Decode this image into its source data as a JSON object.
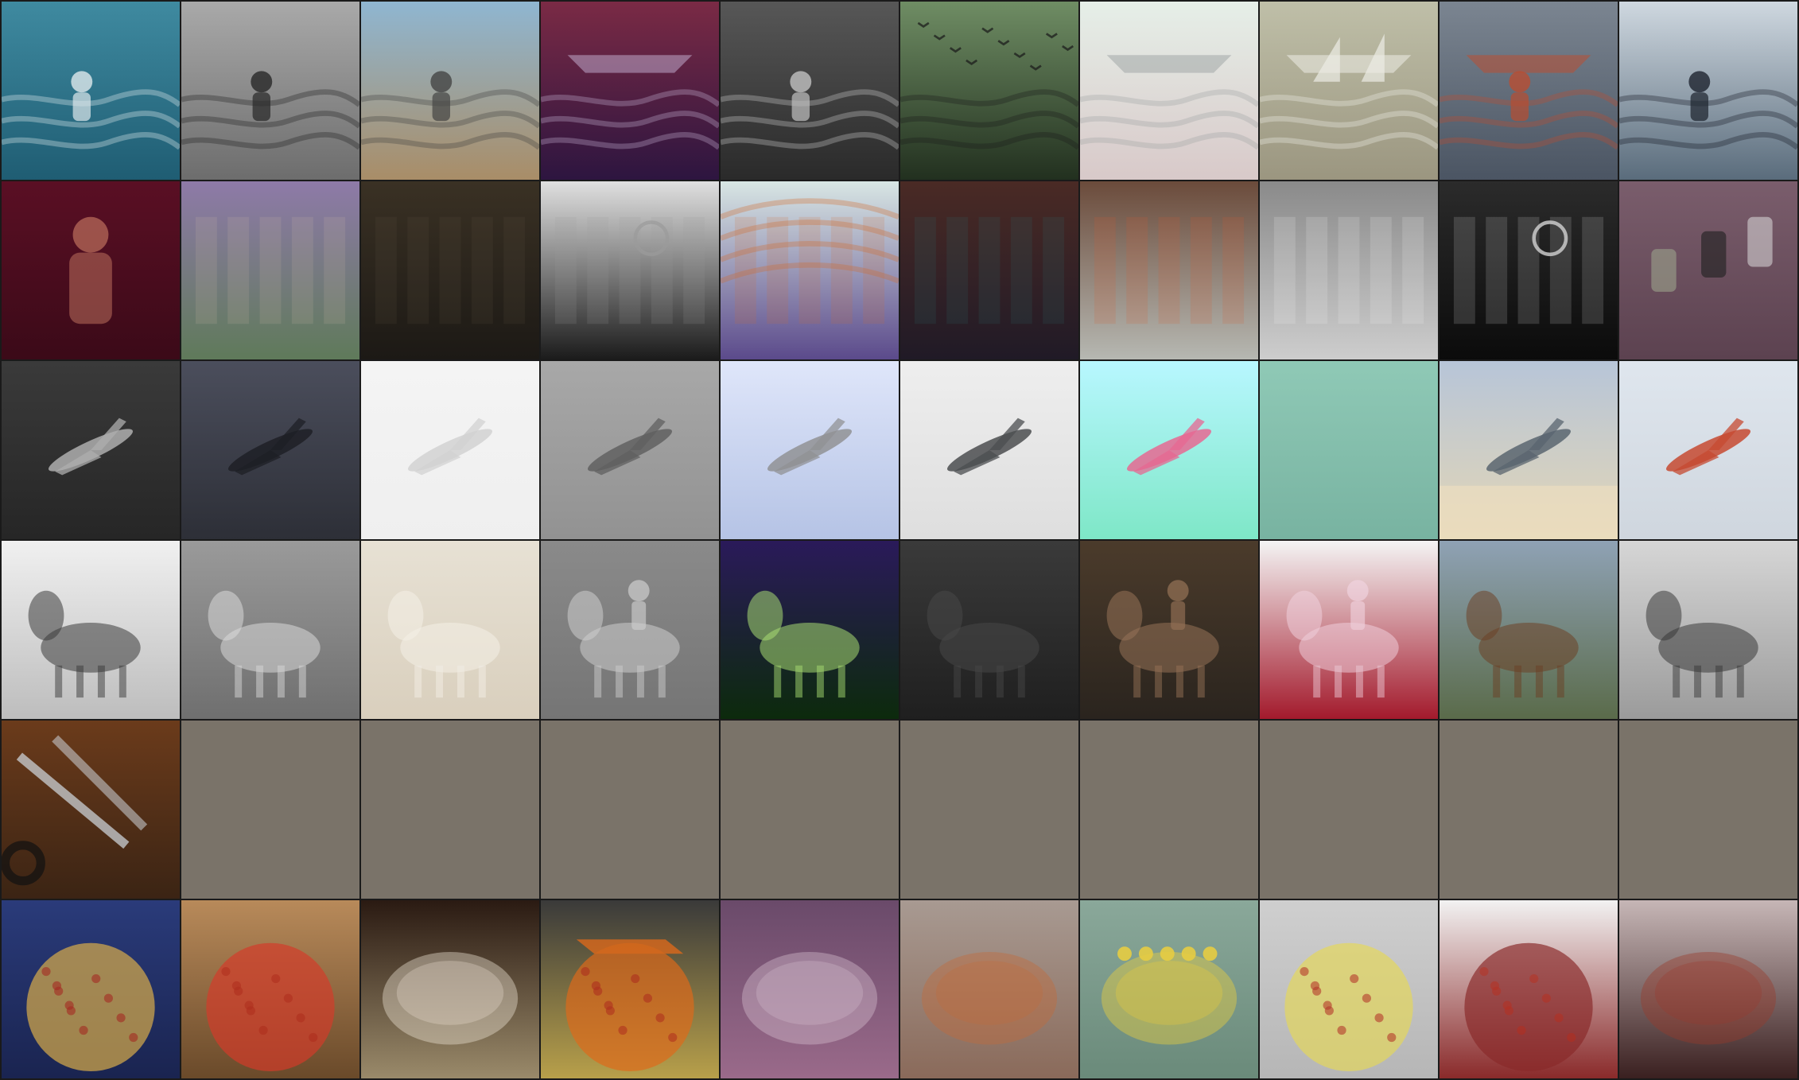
{
  "grid": {
    "rows": 6,
    "cols": 10,
    "border_color": "#1a1a1a",
    "empty_tile_color": "#7a7369"
  },
  "tiles": [
    {
      "id": "r1c1",
      "row": 1,
      "col": 1,
      "subject": "woman-bodyboarding-wave",
      "bg": [
        "#3f8aa0",
        "#1f5d73"
      ],
      "fg": "#f1f5f6"
    },
    {
      "id": "r1c2",
      "row": 1,
      "col": 2,
      "subject": "surfer-paddling-grayscale",
      "bg": [
        "#a9a9a9",
        "#6d6d6d"
      ],
      "fg": "#1d1d1d"
    },
    {
      "id": "r1c3",
      "row": 1,
      "col": 3,
      "subject": "beach-lone-figure",
      "bg": [
        "#8fb6d1",
        "#a98d67"
      ],
      "fg": "#3b3b3b"
    },
    {
      "id": "r1c4",
      "row": 1,
      "col": 4,
      "subject": "boat-purple-water",
      "bg": [
        "#7a2a45",
        "#2d1540"
      ],
      "fg": "#c9b6d8"
    },
    {
      "id": "r1c5",
      "row": 1,
      "col": 5,
      "subject": "dark-surf-lone-surfer",
      "bg": [
        "#575757",
        "#2a2a2a"
      ],
      "fg": "#d0d0d0"
    },
    {
      "id": "r1c6",
      "row": 1,
      "col": 6,
      "subject": "birds-over-green-water",
      "bg": [
        "#6f8d64",
        "#22301f"
      ],
      "fg": "#1a1a1a"
    },
    {
      "id": "r1c7",
      "row": 1,
      "col": 7,
      "subject": "faded-beach-boat",
      "bg": [
        "#e6efe8",
        "#d8c9c9"
      ],
      "fg": "#9aa1a0"
    },
    {
      "id": "r1c8",
      "row": 1,
      "col": 8,
      "subject": "sailboats-beach-sepia",
      "bg": [
        "#bfbfa8",
        "#9b9680"
      ],
      "fg": "#f4f4ee"
    },
    {
      "id": "r1c9",
      "row": 1,
      "col": 9,
      "subject": "man-on-red-boat",
      "bg": [
        "#7b8591",
        "#4b5563"
      ],
      "fg": "#c24a2a"
    },
    {
      "id": "r1c10",
      "row": 1,
      "col": 10,
      "subject": "surfer-big-wave",
      "bg": [
        "#cfd8e0",
        "#5a6c7c"
      ],
      "fg": "#101520"
    },
    {
      "id": "r2c1",
      "row": 2,
      "col": 1,
      "subject": "woman-sunglasses-red-wall",
      "bg": [
        "#5a0f24",
        "#3b0a18"
      ],
      "fg": "#c97a64"
    },
    {
      "id": "r2c2",
      "row": 2,
      "col": 2,
      "subject": "mural-two-people",
      "bg": [
        "#8e7aa8",
        "#5f7a5a"
      ],
      "fg": "#cbb7a8"
    },
    {
      "id": "r2c3",
      "row": 2,
      "col": 3,
      "subject": "dark-building-street",
      "bg": [
        "#3a3124",
        "#1c1915"
      ],
      "fg": "#5e5444"
    },
    {
      "id": "r2c4",
      "row": 2,
      "col": 4,
      "subject": "clock-archway-bw",
      "bg": [
        "#e0e0e0",
        "#1b1b1b"
      ],
      "fg": "#9b9b9b"
    },
    {
      "id": "r2c5",
      "row": 2,
      "col": 5,
      "subject": "glass-arched-ceiling",
      "bg": [
        "#d8e6e4",
        "#5b4a8b"
      ],
      "fg": "#d06a2c"
    },
    {
      "id": "r2c6",
      "row": 2,
      "col": 6,
      "subject": "brick-arches-dim",
      "bg": [
        "#4a2a25",
        "#201a26"
      ],
      "fg": "#2e6d6d"
    },
    {
      "id": "r2c7",
      "row": 2,
      "col": 7,
      "subject": "building-balconies-hydrant",
      "bg": [
        "#6b4b3b",
        "#b6b8b2"
      ],
      "fg": "#d65b2a"
    },
    {
      "id": "r2c8",
      "row": 2,
      "col": 8,
      "subject": "blurred-building-bw",
      "bg": [
        "#8a8a8a",
        "#cdcdcd"
      ],
      "fg": "#f2f2f2"
    },
    {
      "id": "r2c9",
      "row": 2,
      "col": 9,
      "subject": "clock-tower-night",
      "bg": [
        "#2b2b2b",
        "#0b0b0b"
      ],
      "fg": "#e6e6e6"
    },
    {
      "id": "r2c10",
      "row": 2,
      "col": 10,
      "subject": "phones-and-foot",
      "bg": [
        "#7a5d6c",
        "#5c4250"
      ],
      "fg": "#9aa08a"
    },
    {
      "id": "r3c1",
      "row": 3,
      "col": 1,
      "subject": "airliner-dark-airport",
      "bg": [
        "#3a3a3a",
        "#262626"
      ],
      "fg": "#bcbcbc"
    },
    {
      "id": "r3c2",
      "row": 3,
      "col": 2,
      "subject": "plane-stormy-sky",
      "bg": [
        "#4b4e5c",
        "#2d2f37"
      ],
      "fg": "#1b1c22"
    },
    {
      "id": "r3c3",
      "row": 3,
      "col": 3,
      "subject": "plane-washed-out",
      "bg": [
        "#f4f4f4",
        "#efefef"
      ],
      "fg": "#cfcfcf"
    },
    {
      "id": "r3c4",
      "row": 3,
      "col": 4,
      "subject": "fighter-jet-blur",
      "bg": [
        "#a8a8a8",
        "#929292"
      ],
      "fg": "#5a5a5a"
    },
    {
      "id": "r3c5",
      "row": 3,
      "col": 5,
      "subject": "airliner-overhead-blue",
      "bg": [
        "#dfe6fa",
        "#b5c3e5"
      ],
      "fg": "#8b8b8b"
    },
    {
      "id": "r3c6",
      "row": 3,
      "col": 6,
      "subject": "fighter-jet-white-sky",
      "bg": [
        "#eeeeee",
        "#dedede"
      ],
      "fg": "#3b3d40"
    },
    {
      "id": "r3c7",
      "row": 3,
      "col": 7,
      "subject": "pink-jet-aqua-sky",
      "bg": [
        "#b8f7ff",
        "#7ee7c7"
      ],
      "fg": "#ef5a8a"
    },
    {
      "id": "r3c8",
      "row": 3,
      "col": 8,
      "subject": "teal-sky-fragment",
      "bg": [
        "#8fc9b6",
        "#78b3a1"
      ],
      "fg": "#0f3c3a"
    },
    {
      "id": "r3c9",
      "row": 3,
      "col": 9,
      "subject": "b29-bomber-display",
      "bg": [
        "#b7c5d8",
        "#e3d6b6"
      ],
      "fg": "#4d5a66"
    },
    {
      "id": "r3c10",
      "row": 3,
      "col": 10,
      "subject": "red-jet-overhead",
      "bg": [
        "#dfe6ee",
        "#cfd6de"
      ],
      "fg": "#c43a1d"
    },
    {
      "id": "r4c1",
      "row": 4,
      "col": 1,
      "subject": "mules-with-packs-bw",
      "bg": [
        "#f0f0f0",
        "#bdbdbd"
      ],
      "fg": "#2a2a2a"
    },
    {
      "id": "r4c2",
      "row": 4,
      "col": 2,
      "subject": "sheep-leaping-gray",
      "bg": [
        "#9a9a9a",
        "#6f6f6f"
      ],
      "fg": "#e2e2e2"
    },
    {
      "id": "r4c3",
      "row": 4,
      "col": 3,
      "subject": "white-horse-faded",
      "bg": [
        "#e7e1d4",
        "#d9cfbd"
      ],
      "fg": "#f6f2ea"
    },
    {
      "id": "r4c4",
      "row": 4,
      "col": 4,
      "subject": "rider-white-horse-fog",
      "bg": [
        "#8a8a8a",
        "#757575"
      ],
      "fg": "#d6d6d6"
    },
    {
      "id": "r4c5",
      "row": 4,
      "col": 5,
      "subject": "neon-animal-head",
      "bg": [
        "#2a1a5a",
        "#0c2a0c"
      ],
      "fg": "#b8f07a"
    },
    {
      "id": "r4c6",
      "row": 4,
      "col": 6,
      "subject": "dark-cow-closeup",
      "bg": [
        "#3a3a3a",
        "#1f1f1f"
      ],
      "fg": "#4a4a4a"
    },
    {
      "id": "r4c7",
      "row": 4,
      "col": 7,
      "subject": "man-with-horse-stable",
      "bg": [
        "#4b3b2b",
        "#2a241e"
      ],
      "fg": "#a07a5c"
    },
    {
      "id": "r4c8",
      "row": 4,
      "col": 8,
      "subject": "girl-riding-white-pony",
      "bg": [
        "#f4f4f4",
        "#a31a2c"
      ],
      "fg": "#f2d6e2"
    },
    {
      "id": "r4c9",
      "row": 4,
      "col": 9,
      "subject": "brown-horse-head",
      "bg": [
        "#8fa2b5",
        "#5a6b4a"
      ],
      "fg": "#6b3a1e"
    },
    {
      "id": "r4c10",
      "row": 4,
      "col": 10,
      "subject": "horse-carriage-reflection",
      "bg": [
        "#d6d6d6",
        "#9b9b9b"
      ],
      "fg": "#2b2b2b"
    },
    {
      "id": "r5c1",
      "row": 5,
      "col": 1,
      "subject": "scissors-on-wood-box",
      "bg": [
        "#6b3b1b",
        "#3b2414"
      ],
      "fg": "#cfd6dc"
    },
    {
      "id": "r5c2",
      "row": 5,
      "col": 2,
      "subject": "empty",
      "bg": [
        "#7a7369",
        "#7a7369"
      ],
      "fg": "#7a7369"
    },
    {
      "id": "r5c3",
      "row": 5,
      "col": 3,
      "subject": "empty",
      "bg": [
        "#7a7369",
        "#7a7369"
      ],
      "fg": "#7a7369"
    },
    {
      "id": "r5c4",
      "row": 5,
      "col": 4,
      "subject": "empty",
      "bg": [
        "#7a7369",
        "#7a7369"
      ],
      "fg": "#7a7369"
    },
    {
      "id": "r5c5",
      "row": 5,
      "col": 5,
      "subject": "empty",
      "bg": [
        "#7a7369",
        "#7a7369"
      ],
      "fg": "#7a7369"
    },
    {
      "id": "r5c6",
      "row": 5,
      "col": 6,
      "subject": "empty",
      "bg": [
        "#7a7369",
        "#7a7369"
      ],
      "fg": "#7a7369"
    },
    {
      "id": "r5c7",
      "row": 5,
      "col": 7,
      "subject": "empty",
      "bg": [
        "#7a7369",
        "#7a7369"
      ],
      "fg": "#7a7369"
    },
    {
      "id": "r5c8",
      "row": 5,
      "col": 8,
      "subject": "empty",
      "bg": [
        "#7a7369",
        "#7a7369"
      ],
      "fg": "#7a7369"
    },
    {
      "id": "r5c9",
      "row": 5,
      "col": 9,
      "subject": "empty",
      "bg": [
        "#7a7369",
        "#7a7369"
      ],
      "fg": "#7a7369"
    },
    {
      "id": "r5c10",
      "row": 5,
      "col": 10,
      "subject": "empty",
      "bg": [
        "#7a7369",
        "#7a7369"
      ],
      "fg": "#7a7369"
    },
    {
      "id": "r6c1",
      "row": 6,
      "col": 1,
      "subject": "veggie-pizza-table",
      "bg": [
        "#2a3b7a",
        "#1a2450"
      ],
      "fg": "#e0b14a"
    },
    {
      "id": "r6c2",
      "row": 6,
      "col": 2,
      "subject": "square-pizza-pans",
      "bg": [
        "#b88a5a",
        "#6a4a2a"
      ],
      "fg": "#d53b2a"
    },
    {
      "id": "r6c3",
      "row": 6,
      "col": 3,
      "subject": "chocolate-bundt-cakes",
      "bg": [
        "#2a1a12",
        "#9a8a6a"
      ],
      "fg": "#f0e6d8"
    },
    {
      "id": "r6c4",
      "row": 6,
      "col": 4,
      "subject": "orange-scooter-pizza",
      "bg": [
        "#3a3a3a",
        "#b8a04a"
      ],
      "fg": "#e06a1a"
    },
    {
      "id": "r6c5",
      "row": 6,
      "col": 5,
      "subject": "noodle-bowl-purple",
      "bg": [
        "#6a4a6a",
        "#9a6a8a"
      ],
      "fg": "#d8c2d0"
    },
    {
      "id": "r6c6",
      "row": 6,
      "col": 6,
      "subject": "stew-pot",
      "bg": [
        "#a89a92",
        "#8a6a5a"
      ],
      "fg": "#c46a3a"
    },
    {
      "id": "r6c7",
      "row": 6,
      "col": 7,
      "subject": "food-trays-flowers",
      "bg": [
        "#8aa89a",
        "#6a8a7a"
      ],
      "fg": "#f2d23a"
    },
    {
      "id": "r6c8",
      "row": 6,
      "col": 8,
      "subject": "cheese-pizza-pan",
      "bg": [
        "#cfcfcf",
        "#b6b6b6"
      ],
      "fg": "#e6d85a"
    },
    {
      "id": "r6c9",
      "row": 6,
      "col": 9,
      "subject": "pizza-slices-collage",
      "bg": [
        "#f2f2f2",
        "#8a2a2a"
      ],
      "fg": "#8a2a2a"
    },
    {
      "id": "r6c10",
      "row": 6,
      "col": 10,
      "subject": "hot-dog-closeup",
      "bg": [
        "#c6b6b6",
        "#3a2020"
      ],
      "fg": "#9a3a2a"
    }
  ]
}
